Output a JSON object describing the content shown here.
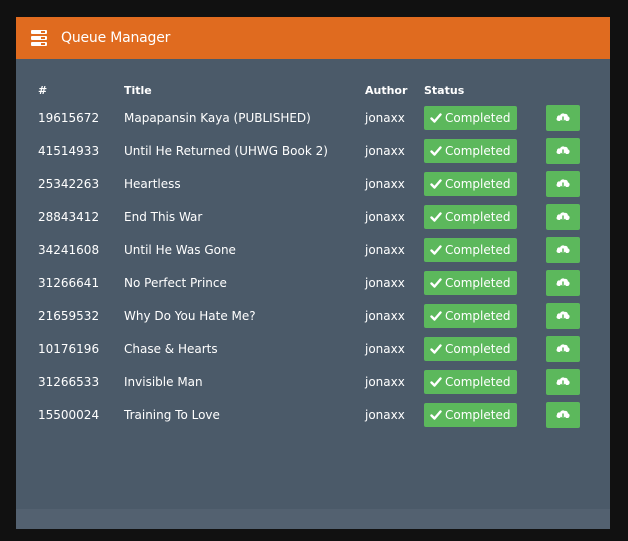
{
  "header": {
    "title": "Queue Manager",
    "icon": "server-icon",
    "color": "#e06b1f"
  },
  "table": {
    "columns": {
      "id": "#",
      "title": "Title",
      "author": "Author",
      "status": "Status"
    },
    "rows": [
      {
        "id": "19615672",
        "title": "Mapapansin Kaya (PUBLISHED)",
        "author": "jonaxx",
        "status": "Completed"
      },
      {
        "id": "41514933",
        "title": "Until He Returned (UHWG Book 2)",
        "author": "jonaxx",
        "status": "Completed"
      },
      {
        "id": "25342263",
        "title": "Heartless",
        "author": "jonaxx",
        "status": "Completed"
      },
      {
        "id": "28843412",
        "title": "End This War",
        "author": "jonaxx",
        "status": "Completed"
      },
      {
        "id": "34241608",
        "title": "Until He Was Gone",
        "author": "jonaxx",
        "status": "Completed"
      },
      {
        "id": "31266641",
        "title": "No Perfect Prince",
        "author": "jonaxx",
        "status": "Completed"
      },
      {
        "id": "21659532",
        "title": "Why Do You Hate Me?",
        "author": "jonaxx",
        "status": "Completed"
      },
      {
        "id": "10176196",
        "title": "Chase & Hearts",
        "author": "jonaxx",
        "status": "Completed"
      },
      {
        "id": "31266533",
        "title": "Invisible Man",
        "author": "jonaxx",
        "status": "Completed"
      },
      {
        "id": "15500024",
        "title": "Training To Love",
        "author": "jonaxx",
        "status": "Completed"
      }
    ]
  },
  "colors": {
    "panel_bg": "#4b5a69",
    "success": "#5cb85c"
  }
}
